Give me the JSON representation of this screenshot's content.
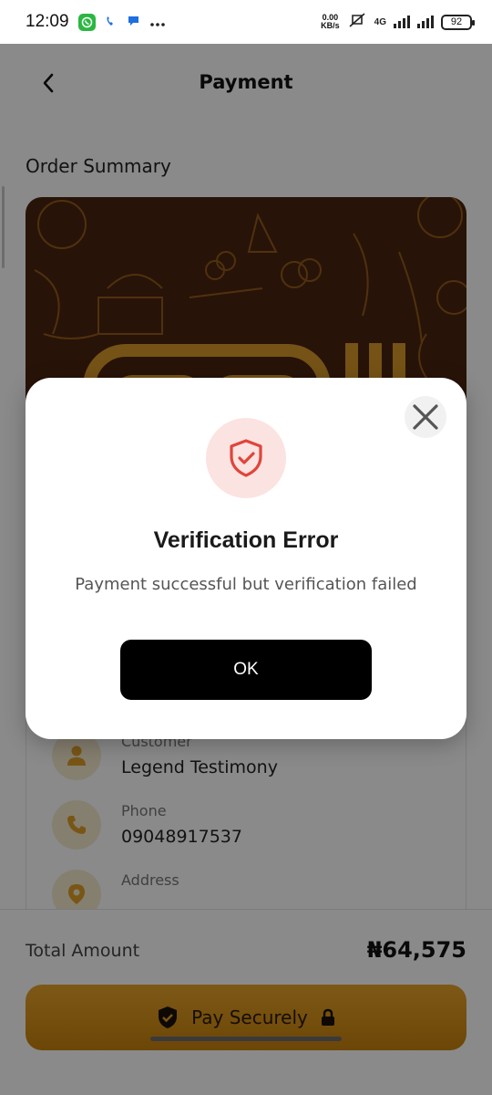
{
  "status_bar": {
    "time": "12:09",
    "net_speed_value": "0.00",
    "net_speed_unit": "KB/s",
    "network": "4G",
    "battery": "92",
    "icons": [
      "whatsapp-icon",
      "call-icon",
      "message-icon",
      "more-dots-icon",
      "mute-icon",
      "signal-icon",
      "battery-icon"
    ]
  },
  "header": {
    "title": "Payment",
    "back_icon": "chevron-left-icon"
  },
  "order_summary": {
    "title": "Order Summary"
  },
  "details": [
    {
      "label": "Customer",
      "value": "Legend Testimony",
      "icon": "person-icon"
    },
    {
      "label": "Phone",
      "value": "09048917537",
      "icon": "phone-icon"
    },
    {
      "label": "Address",
      "value": "",
      "icon": "location-icon"
    }
  ],
  "footer": {
    "total_label": "Total Amount",
    "total_value": "₦64,575",
    "pay_button_label": "Pay Securely"
  },
  "dialog": {
    "title": "Verification Error",
    "message": "Payment successful but verification failed",
    "ok_label": "OK",
    "icon": "shield-check-icon"
  },
  "colors": {
    "accent": "#e0a02a",
    "banner_bg": "#4b2410",
    "error_tint": "#fbe3e1",
    "error_icon": "#e0453a",
    "primary_button": "#000000"
  }
}
